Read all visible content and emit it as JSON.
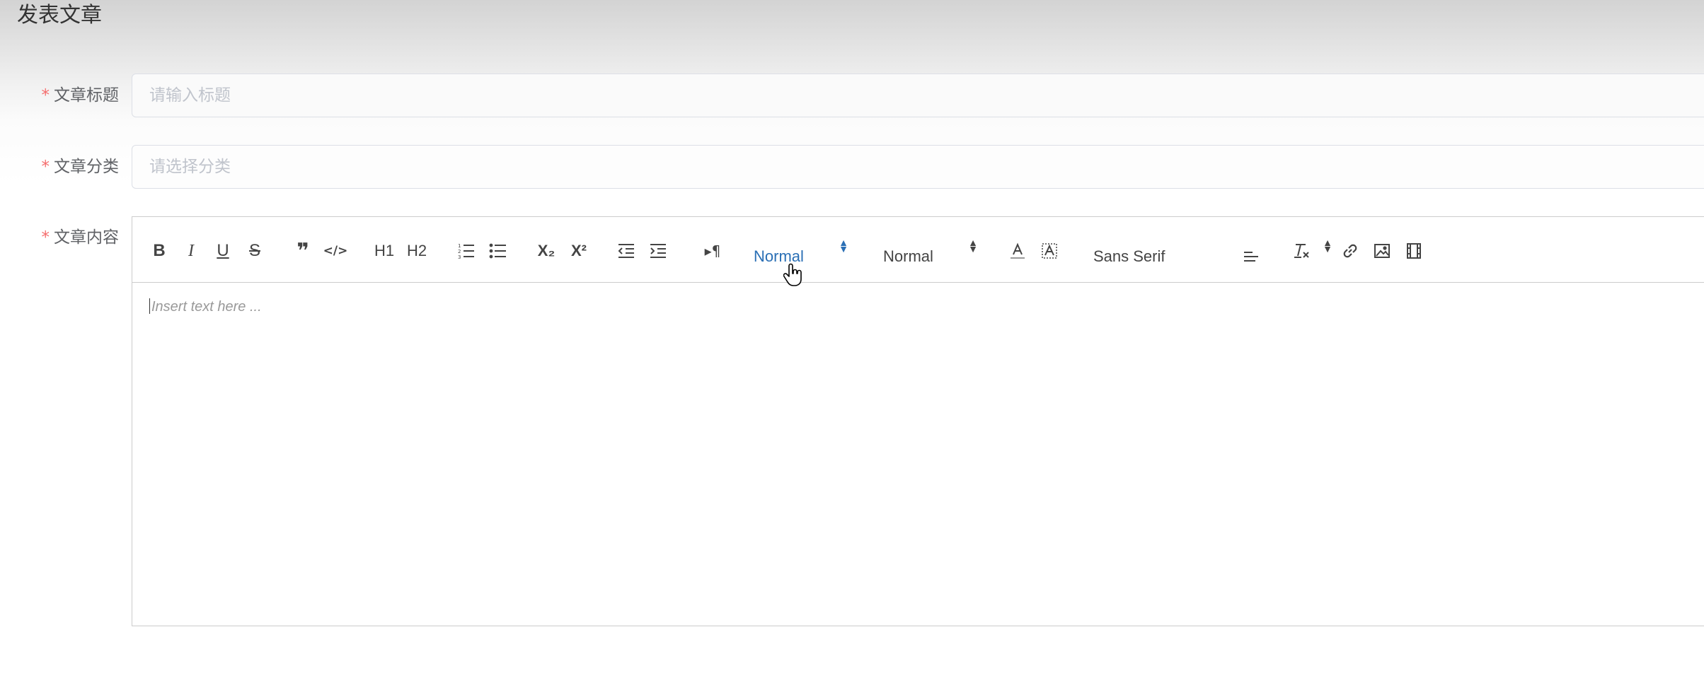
{
  "page": {
    "title": "发表文章"
  },
  "form": {
    "required_mark": "*",
    "title_field": {
      "label": "文章标题",
      "placeholder": "请输入标题"
    },
    "category_field": {
      "label": "文章分类",
      "placeholder": "请选择分类"
    },
    "content_field": {
      "label": "文章内容"
    }
  },
  "editor": {
    "toolbar": {
      "bold": "B",
      "italic": "I",
      "underline": "U",
      "strike": "S",
      "blockquote": "❞",
      "code_block": "</>",
      "h1": "H1",
      "h2": "H2",
      "ordered_list": "ordered-list-icon",
      "bullet_list": "bullet-list-icon",
      "subscript": "X₂",
      "superscript": "X²",
      "outdent": "outdent-icon",
      "indent": "indent-icon",
      "direction": "▸¶",
      "header_picker": "Normal",
      "size_picker": "Normal",
      "font_picker": "Sans Serif",
      "color": "color-icon",
      "background": "background-icon",
      "align": "align-icon",
      "clean": "clean-format-icon",
      "link": "link-icon",
      "image": "image-icon",
      "video": "video-icon"
    },
    "placeholder": "Insert text here ..."
  },
  "colors": {
    "required": "#f56c6c",
    "active_picker": "#2a6fb5",
    "toolbar_icon": "#444444"
  }
}
